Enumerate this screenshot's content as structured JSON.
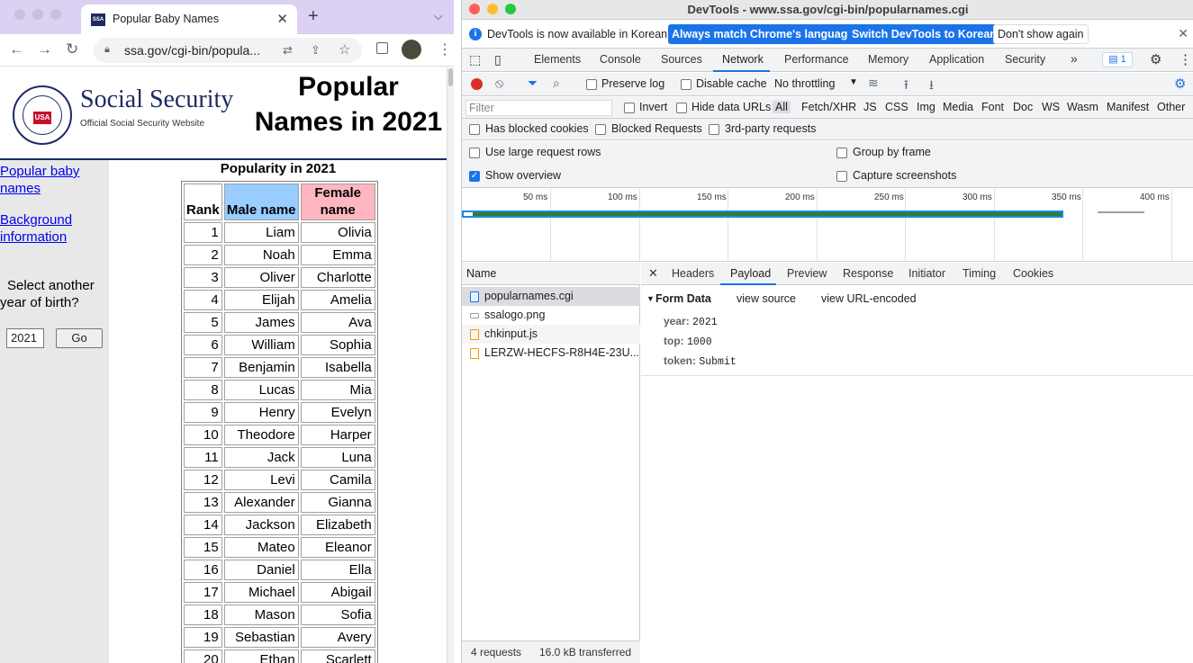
{
  "browser": {
    "tab_title": "Popular Baby Names",
    "favicon_text": "SSA",
    "url": "ssa.gov/cgi-bin/popula..."
  },
  "page": {
    "ss_title": "Social Security",
    "ss_subtitle": "Official Social Security Website",
    "seal_text": "USA",
    "main_title_line1": "Popular",
    "main_title_line2": "Names in 2021",
    "nav_link1_line1": "Popular baby",
    "nav_link1_line2": "names",
    "nav_link2_line1": "Background",
    "nav_link2_line2": "information",
    "select_line1": "Select another",
    "select_line2": "year of birth?",
    "year_value": "2021",
    "go_label": "Go",
    "table_caption": "Popularity in 2021",
    "col_rank": "Rank",
    "col_male": "Male name",
    "col_female_line1": "Female",
    "col_female_line2": "name",
    "rows": [
      {
        "rank": "1",
        "male": "Liam",
        "female": "Olivia"
      },
      {
        "rank": "2",
        "male": "Noah",
        "female": "Emma"
      },
      {
        "rank": "3",
        "male": "Oliver",
        "female": "Charlotte"
      },
      {
        "rank": "4",
        "male": "Elijah",
        "female": "Amelia"
      },
      {
        "rank": "5",
        "male": "James",
        "female": "Ava"
      },
      {
        "rank": "6",
        "male": "William",
        "female": "Sophia"
      },
      {
        "rank": "7",
        "male": "Benjamin",
        "female": "Isabella"
      },
      {
        "rank": "8",
        "male": "Lucas",
        "female": "Mia"
      },
      {
        "rank": "9",
        "male": "Henry",
        "female": "Evelyn"
      },
      {
        "rank": "10",
        "male": "Theodore",
        "female": "Harper"
      },
      {
        "rank": "11",
        "male": "Jack",
        "female": "Luna"
      },
      {
        "rank": "12",
        "male": "Levi",
        "female": "Camila"
      },
      {
        "rank": "13",
        "male": "Alexander",
        "female": "Gianna"
      },
      {
        "rank": "14",
        "male": "Jackson",
        "female": "Elizabeth"
      },
      {
        "rank": "15",
        "male": "Mateo",
        "female": "Eleanor"
      },
      {
        "rank": "16",
        "male": "Daniel",
        "female": "Ella"
      },
      {
        "rank": "17",
        "male": "Michael",
        "female": "Abigail"
      },
      {
        "rank": "18",
        "male": "Mason",
        "female": "Sofia"
      },
      {
        "rank": "19",
        "male": "Sebastian",
        "female": "Avery"
      },
      {
        "rank": "20",
        "male": "Ethan",
        "female": "Scarlett"
      }
    ]
  },
  "devtools": {
    "window_title": "DevTools - www.ssa.gov/cgi-bin/popularnames.cgi",
    "info_message": "DevTools is now available in Korean!",
    "info_btn1": "Always match Chrome's language",
    "info_btn2": "Switch DevTools to Korean",
    "info_btn3": "Don't show again",
    "panel_tabs": [
      "Elements",
      "Console",
      "Sources",
      "Network",
      "Performance",
      "Memory",
      "Application",
      "Security"
    ],
    "more_tabs": "»",
    "message_count": "1",
    "preserve_log": "Preserve log",
    "disable_cache": "Disable cache",
    "throttling": "No throttling",
    "filter_placeholder": "Filter",
    "invert": "Invert",
    "hide_data_urls": "Hide data URLs",
    "filter_types": [
      "All",
      "Fetch/XHR",
      "JS",
      "CSS",
      "Img",
      "Media",
      "Font",
      "Doc",
      "WS",
      "Wasm",
      "Manifest",
      "Other"
    ],
    "has_blocked_cookies": "Has blocked cookies",
    "blocked_requests": "Blocked Requests",
    "third_party": "3rd-party requests",
    "large_rows": "Use large request rows",
    "group_by_frame": "Group by frame",
    "show_overview": "Show overview",
    "capture_screenshots": "Capture screenshots",
    "ticks": [
      "50 ms",
      "100 ms",
      "150 ms",
      "200 ms",
      "250 ms",
      "300 ms",
      "350 ms",
      "400 ms"
    ],
    "name_header": "Name",
    "requests": [
      "popularnames.cgi",
      "ssalogo.png",
      "chkinput.js",
      "LERZW-HECFS-R8H4E-23U..."
    ],
    "footer_requests": "4 requests",
    "footer_transferred": "16.0 kB transferred",
    "detail_tabs": [
      "Headers",
      "Payload",
      "Preview",
      "Response",
      "Initiator",
      "Timing",
      "Cookies"
    ],
    "form_data_label": "Form Data",
    "view_source": "view source",
    "view_url_encoded": "view URL-encoded",
    "form_fields": [
      {
        "key": "year:",
        "value": "2021"
      },
      {
        "key": "top:",
        "value": "1000"
      },
      {
        "key": "token:",
        "value": "Submit"
      }
    ],
    "colors": {
      "accent": "#1a73e8",
      "record": "#d93025"
    }
  }
}
